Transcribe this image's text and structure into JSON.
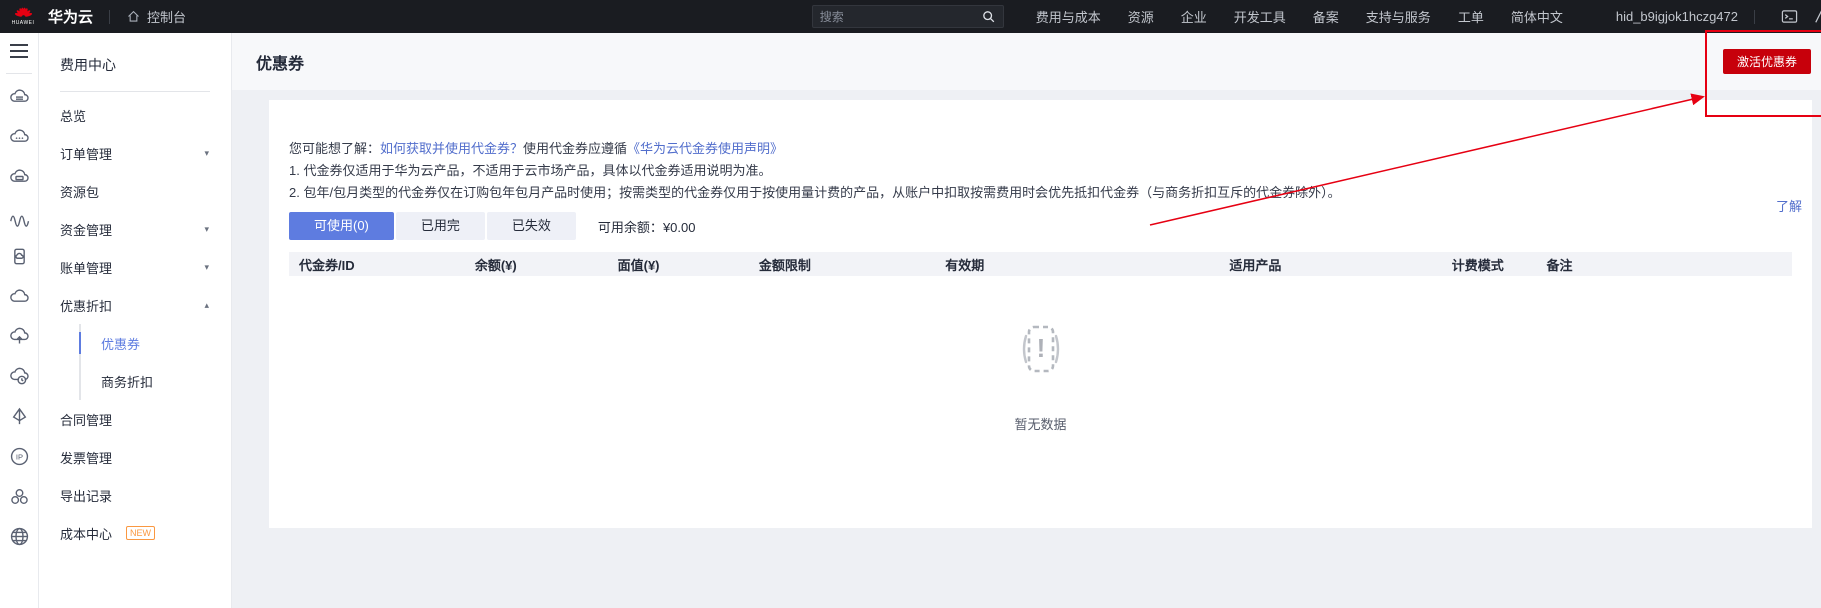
{
  "topbar": {
    "brand": "华为云",
    "brand_sub": "HUAWEI",
    "console_label": "控制台",
    "search_placeholder": "搜索",
    "nav": {
      "billing": "费用与成本",
      "resources": "资源",
      "enterprise": "企业",
      "devtools": "开发工具",
      "beian": "备案",
      "support": "支持与服务",
      "ticket": "工单",
      "lang": "简体中文",
      "account": "hid_b9igjok1hczg472"
    }
  },
  "icon_strip": [
    "menu-icon",
    "cloud-server-icon",
    "cloud-ellipsis-icon",
    "cloud-card-icon",
    "waves-icon",
    "device-icon",
    "cloud-icon",
    "cloud-upload-icon",
    "cloud-clock-icon",
    "balance-icon",
    "ip-icon",
    "user-group-icon",
    "globe-icon"
  ],
  "sidebar": {
    "title": "费用中心",
    "items": [
      {
        "label": "总览"
      },
      {
        "label": "订单管理",
        "caret": "▾"
      },
      {
        "label": "资源包"
      },
      {
        "label": "资金管理",
        "caret": "▾"
      },
      {
        "label": "账单管理",
        "caret": "▾"
      },
      {
        "label": "优惠折扣",
        "caret": "▴"
      },
      {
        "label": "优惠券"
      },
      {
        "label": "商务折扣"
      },
      {
        "label": "合同管理"
      },
      {
        "label": "发票管理"
      },
      {
        "label": "导出记录"
      },
      {
        "label": "成本中心",
        "badge": "NEW"
      }
    ]
  },
  "page": {
    "title": "优惠券",
    "activate_button": "激活优惠券",
    "notice_prefix": "您可能想了解：",
    "notice_link1": "如何获取并使用代金券？",
    "notice_mid": "使用代金券应遵循",
    "notice_link2": "《华为云代金券使用声明》",
    "rule1": "1. 代金券仅适用于华为云产品，不适用于云市场产品，具体以代金券适用说明为准。",
    "rule2": "2. 包年/包月类型的代金券仅在订购包年包月产品时使用；按需类型的代金券仅用于按使用量计费的产品，从账户中扣取按需费用时会优先抵扣代金券（与商务折扣互斥的代金券除外）。",
    "learn_link": "了解",
    "tabs": {
      "available": "可使用(0)",
      "used": "已用完",
      "expired": "已失效"
    },
    "balance_label": "可用余额：",
    "balance_value": "¥0.00",
    "table_headers": [
      "代金券/ID",
      "余额(¥)",
      "面值(¥)",
      "金额限制",
      "有效期",
      "适用产品",
      "计费模式",
      "备注"
    ],
    "empty_text": "暂无数据"
  },
  "colors": {
    "accent": "#5e7ce0",
    "link": "#526ecc",
    "button_red": "#c7000b",
    "annotation_red": "#e60012",
    "badge_orange": "#fa9841",
    "topbar_bg": "#1a1c21"
  }
}
